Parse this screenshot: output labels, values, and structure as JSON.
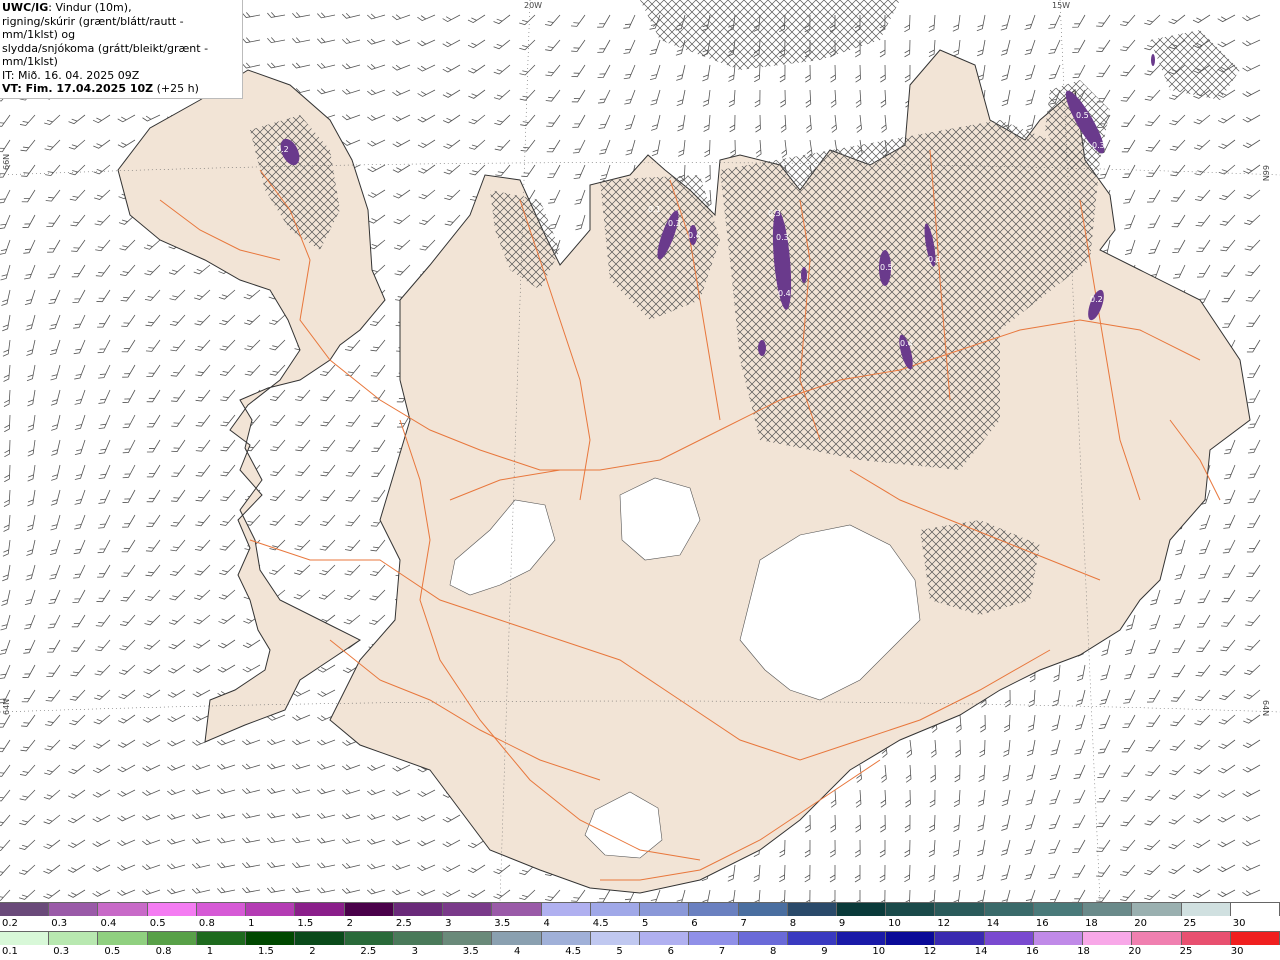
{
  "info": {
    "model_label": "UWC/IG",
    "line1_rest": ": Vindur (10m),",
    "line2": "rigning/skúrir (grænt/blátt/rautt - mm/1klst) og",
    "line3": "slydda/snjókoma (grátt/bleikt/grænt - mm/1klst)",
    "line4": "IT: Mið. 16. 04. 2025 09Z",
    "line5_label": "VT: Fim. 17.04.2025 10Z",
    "line5_rest": " (+25 h)"
  },
  "grid_labels": {
    "lon_20w": "20W",
    "lon_15w": "15W",
    "lat_66n_left": "66N",
    "lat_66n_right": "66N",
    "lat_64n_left": "64N",
    "lat_64n_right": "64N"
  },
  "precip_labels": [
    "0.2",
    "0.1",
    "0.3",
    "0.4",
    "0.3",
    "0.3",
    "0.4",
    "0.5",
    "0.3",
    "0.4",
    "0.5",
    "0.3",
    "0.2"
  ],
  "colors": {
    "land": "#f2e4d6",
    "coast": "#333333",
    "roads": "#e8773c",
    "hatch": "#555555",
    "precip": "#6a3a8c",
    "wind": "#555555"
  },
  "legend_snow": {
    "labels": [
      "0.2",
      "0.3",
      "0.4",
      "0.5",
      "0.8",
      "1",
      "1.5",
      "2",
      "2.5",
      "3",
      "3.5",
      "4",
      "4.5",
      "5",
      "6",
      "7",
      "8",
      "9",
      "10",
      "12",
      "14",
      "16",
      "18",
      "20",
      "25",
      "30"
    ],
    "colors": [
      "#6a4a7a",
      "#9a5aa8",
      "#c86ac8",
      "#f47cf2",
      "#d65ad6",
      "#b43cb4",
      "#8a1e8a",
      "#4a004a",
      "#6a2a7a",
      "#7a3a8a",
      "#9a5aa8",
      "#b0b0f0",
      "#a0a8e8",
      "#8a98d8",
      "#6a80c0",
      "#4a6ea0",
      "#2a4a6a",
      "#0a3a3a",
      "#1a4a4a",
      "#2a5a5a",
      "#3a6a6a",
      "#4a7a7a",
      "#6a8a8a",
      "#9ab0b0",
      "#d0e0e0",
      "#ffffff"
    ]
  },
  "legend_rain": {
    "labels": [
      "0.1",
      "0.3",
      "0.5",
      "0.8",
      "1",
      "1.5",
      "2",
      "2.5",
      "3",
      "3.5",
      "4",
      "4.5",
      "5",
      "6",
      "7",
      "8",
      "9",
      "10",
      "12",
      "14",
      "16",
      "18",
      "20",
      "25",
      "30"
    ],
    "colors": [
      "#d8f8d8",
      "#b8e8b0",
      "#90d080",
      "#58a048",
      "#1e6a1e",
      "#004800",
      "#0a4a1a",
      "#2a6a3a",
      "#4a7a5a",
      "#6a8a7a",
      "#8aa0b0",
      "#a0b0d8",
      "#c0c8f0",
      "#b0b0f0",
      "#9090e8",
      "#6a6ad8",
      "#3a3ac0",
      "#1a1aa8",
      "#0a0a98",
      "#3a2ab0",
      "#7a4ad0",
      "#c08ae8",
      "#f8a8e8",
      "#f080b0",
      "#e85070",
      "#f02020"
    ]
  }
}
